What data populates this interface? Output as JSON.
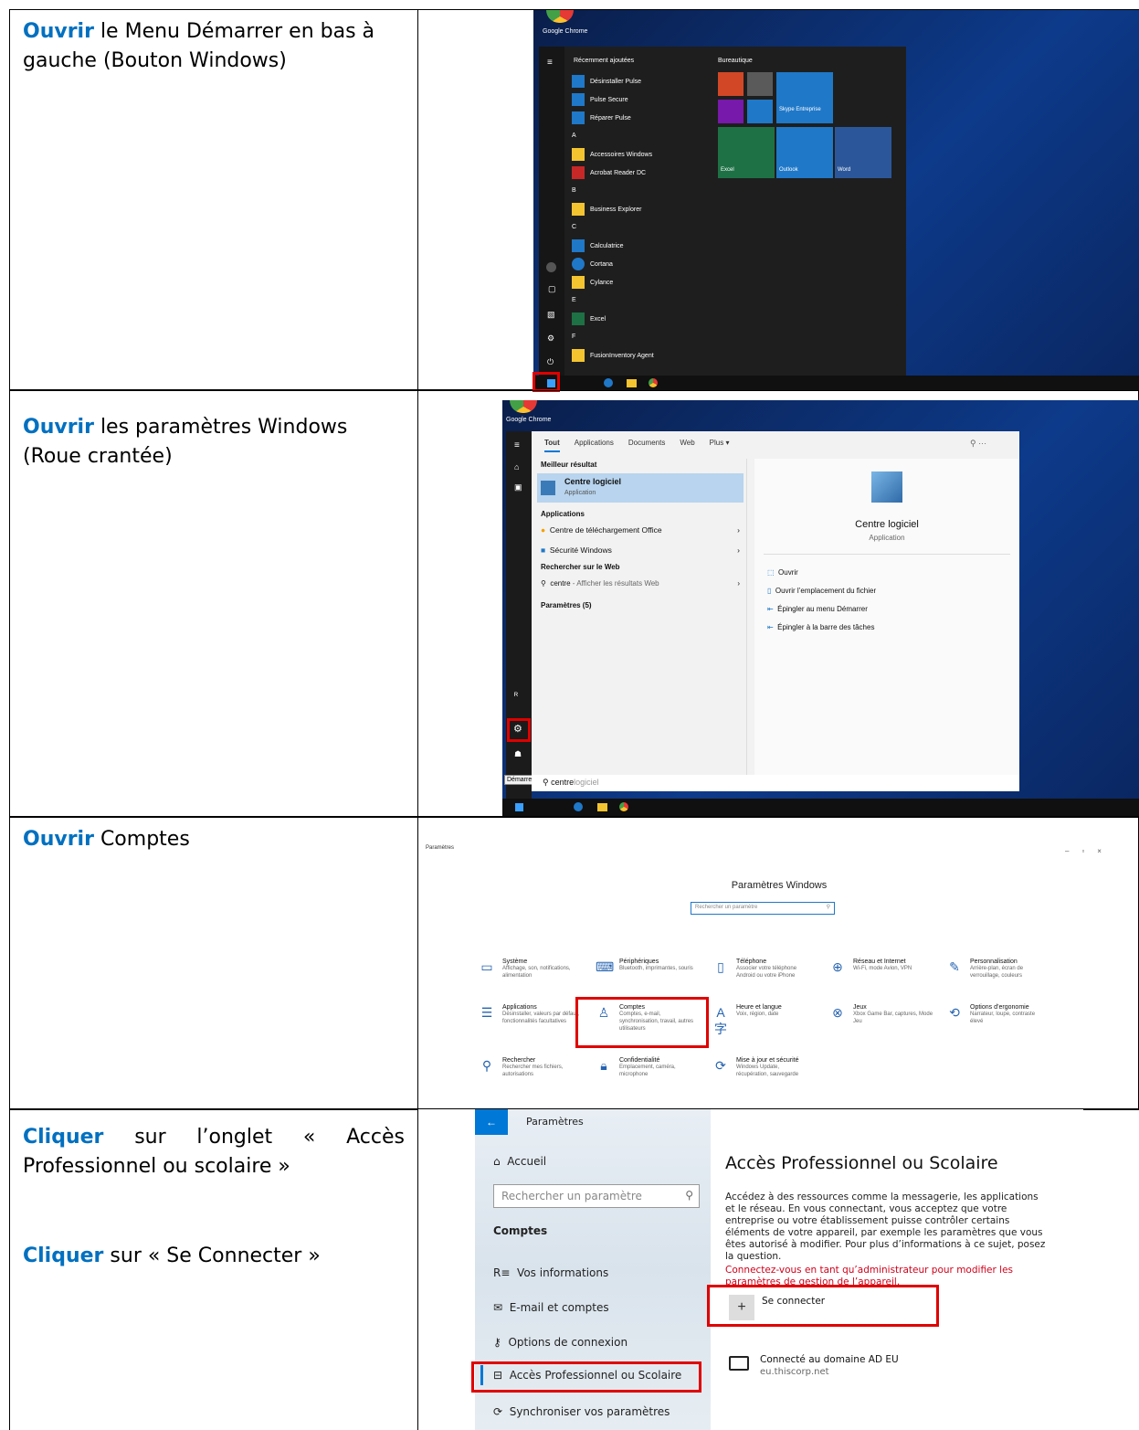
{
  "rows": [
    {
      "verb": "Ouvrir",
      "text": " le Menu Démarrer en bas à gauche (Bouton Windows)"
    },
    {
      "verb": "Ouvrir",
      "text": " les paramètres Windows (Roue crantée)"
    },
    {
      "verb": "Ouvrir",
      "text": " Comptes"
    },
    {
      "verb": "Cliquer",
      "text": " sur l’onglet « Accès Professionnel ou scolaire »",
      "verb2": "Cliquer",
      "text2": " sur « Se Connecter »"
    }
  ],
  "startmenu": {
    "chrome_label": "Google Chrome",
    "recent_title": "Récemment ajoutées",
    "recent": [
      "Désinstaller Pulse",
      "Pulse Secure",
      "Réparer Pulse"
    ],
    "groups": [
      {
        "letter": "A",
        "items": [
          "Accessoires Windows",
          "Acrobat Reader DC"
        ]
      },
      {
        "letter": "B",
        "items": [
          "Business Explorer"
        ]
      },
      {
        "letter": "C",
        "items": [
          "Calculatrice",
          "Cortana",
          "Cylance"
        ]
      },
      {
        "letter": "E",
        "items": [
          "Excel"
        ]
      },
      {
        "letter": "F",
        "items": [
          "FusionInventory Agent"
        ]
      }
    ],
    "tiles_title": "Bureautique",
    "tiles": {
      "skype": "Skype Entreprise",
      "excel": "Excel",
      "outlook": "Outlook",
      "word": "Word"
    }
  },
  "search": {
    "chrome_label": "Google Chrome",
    "tabs": [
      "Tout",
      "Applications",
      "Documents",
      "Web",
      "Plus ▾"
    ],
    "best_heading": "Meilleur résultat",
    "best_title": "Centre logiciel",
    "best_sub": "Application",
    "apps_heading": "Applications",
    "apps": [
      "Centre de téléchargement Office",
      "Sécurité Windows"
    ],
    "web_heading": "Rechercher sur le Web",
    "web_item": "centre",
    "web_suffix": " - Afficher les résultats Web",
    "params_heading": "Paramètres (5)",
    "preview_title": "Centre logiciel",
    "preview_sub": "Application",
    "actions": [
      "Ouvrir",
      "Ouvrir l’emplacement du fichier",
      "Épingler au menu Démarrer",
      "Épingler à la barre des tâches"
    ],
    "query": "centre",
    "query_hint": "logiciel",
    "tooltip": "Démarrer"
  },
  "settings": {
    "window_title": "Paramètres",
    "heading": "Paramètres Windows",
    "search_placeholder": "Rechercher un paramètre",
    "items": [
      {
        "title": "Système",
        "sub": "Affichage, son, notifications, alimentation"
      },
      {
        "title": "Périphériques",
        "sub": "Bluetooth, imprimantes, souris"
      },
      {
        "title": "Téléphone",
        "sub": "Associer votre téléphone Android ou votre iPhone"
      },
      {
        "title": "Réseau et Internet",
        "sub": "Wi-Fi, mode Avion, VPN"
      },
      {
        "title": "Personnalisation",
        "sub": "Arrière-plan, écran de verrouillage, couleurs"
      },
      {
        "title": "Applications",
        "sub": "Désinstaller, valeurs par défaut, fonctionnalités facultatives"
      },
      {
        "title": "Comptes",
        "sub": "Comptes, e-mail, synchronisation, travail, autres utilisateurs"
      },
      {
        "title": "Heure et langue",
        "sub": "Voix, région, date"
      },
      {
        "title": "Jeux",
        "sub": "Xbox Game Bar, captures, Mode Jeu"
      },
      {
        "title": "Options d’ergonomie",
        "sub": "Narrateur, loupe, contraste élevé"
      },
      {
        "title": "Rechercher",
        "sub": "Rechercher mes fichiers, autorisations"
      },
      {
        "title": "Confidentialité",
        "sub": "Emplacement, caméra, microphone"
      },
      {
        "title": "Mise à jour et sécurité",
        "sub": "Windows Update, récupération, sauvegarde"
      }
    ]
  },
  "access": {
    "app_title": "Paramètres",
    "home": "Accueil",
    "search_placeholder": "Rechercher un paramètre",
    "section": "Comptes",
    "nav": [
      "Vos informations",
      "E-mail et comptes",
      "Options de connexion",
      "Accès Professionnel ou Scolaire",
      "Synchroniser vos paramètres"
    ],
    "heading": "Accès Professionnel ou Scolaire",
    "body": "Accédez à des ressources comme la messagerie, les applications et le réseau. En vous connectant, vous acceptez que votre entreprise ou votre établissement puisse contrôler certains éléments de votre appareil, par exemple les paramètres que vous êtes autorisé à modifier. Pour plus d’informations à ce sujet, posez la question.",
    "warning": "Connectez-vous en tant qu’administrateur pour modifier les paramètres de gestion de l’appareil.",
    "connect": "Se connecter",
    "domain_title": "Connecté au domaine AD EU",
    "domain_sub": "eu.thiscorp.net"
  },
  "colors": {
    "verb": "#0070c0",
    "highlight": "#e00000",
    "accent": "#0078d7"
  }
}
